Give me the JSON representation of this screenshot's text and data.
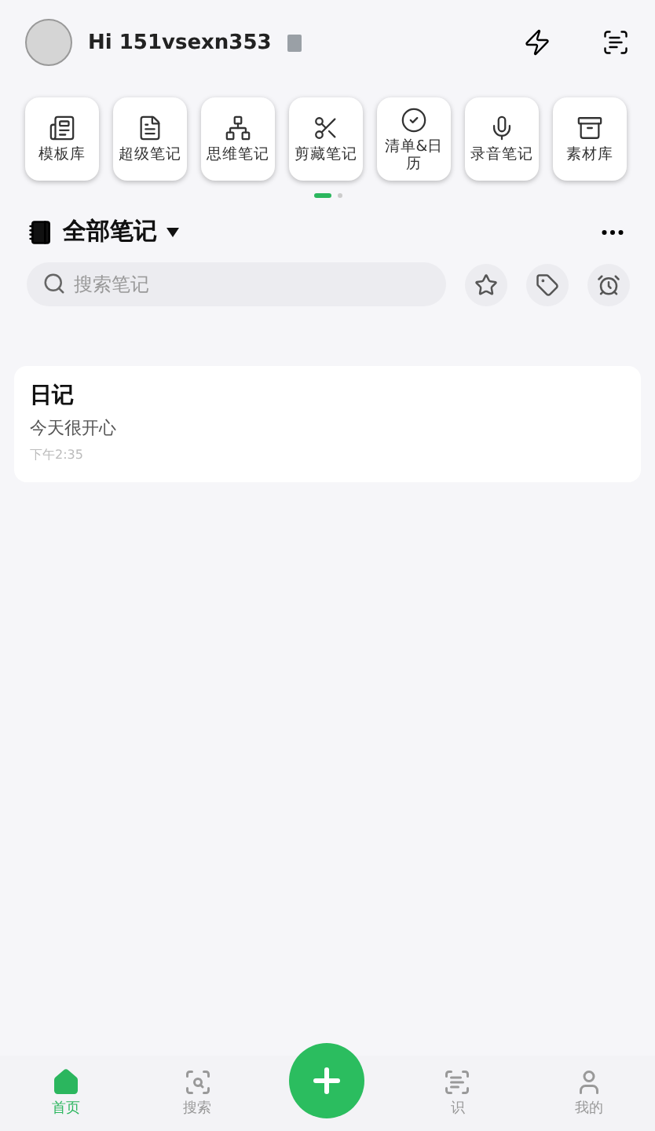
{
  "header": {
    "greeting": "Hi 151vsexn353"
  },
  "shortcuts": [
    {
      "label": "模板库"
    },
    {
      "label": "超级笔记"
    },
    {
      "label": "思维笔记"
    },
    {
      "label": "剪藏笔记"
    },
    {
      "label": "清单&日历"
    },
    {
      "label": "录音笔记"
    },
    {
      "label": "素材库"
    }
  ],
  "pager": [
    {
      "selected": true
    },
    {
      "selected": false
    }
  ],
  "notebook": {
    "title": "全部笔记",
    "search_placeholder": "搜索笔记"
  },
  "notes": [
    {
      "title": "日记",
      "preview": "今天很开心",
      "time": "下午2:35"
    }
  ],
  "nav": [
    {
      "label": "首页",
      "selected": true
    },
    {
      "label": "搜索",
      "selected": false
    },
    {
      "label": "识",
      "selected": false
    },
    {
      "label": "我的",
      "selected": false
    }
  ]
}
